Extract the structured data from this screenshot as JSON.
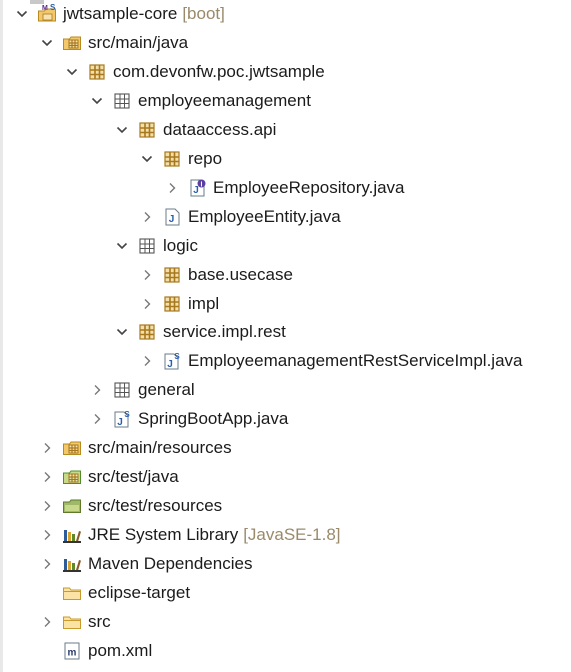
{
  "tree": [
    {
      "id": "jwtsample-core",
      "label": "jwtsample-core",
      "decoration": "[boot]",
      "icon": "project",
      "expanded": true,
      "depth": 0
    },
    {
      "id": "src-main-java",
      "label": "src/main/java",
      "icon": "source-folder",
      "expanded": true,
      "depth": 1
    },
    {
      "id": "pkg-root",
      "label": "com.devonfw.poc.jwtsample",
      "icon": "package",
      "expanded": true,
      "depth": 2
    },
    {
      "id": "pkg-employeemanagement",
      "label": "employeemanagement",
      "icon": "package-empty",
      "expanded": true,
      "depth": 3
    },
    {
      "id": "pkg-dataaccess-api",
      "label": "dataaccess.api",
      "icon": "package",
      "expanded": true,
      "depth": 4
    },
    {
      "id": "pkg-repo",
      "label": "repo",
      "icon": "package",
      "expanded": true,
      "depth": 5
    },
    {
      "id": "file-employeerepository",
      "label": "EmployeeRepository.java",
      "icon": "java-interface",
      "expanded": false,
      "depth": 6
    },
    {
      "id": "file-employeeentity",
      "label": "EmployeeEntity.java",
      "icon": "java-file",
      "expanded": false,
      "depth": 5
    },
    {
      "id": "pkg-logic",
      "label": "logic",
      "icon": "package-empty",
      "expanded": true,
      "depth": 4
    },
    {
      "id": "pkg-base-usecase",
      "label": "base.usecase",
      "icon": "package",
      "expanded": false,
      "depth": 5
    },
    {
      "id": "pkg-impl",
      "label": "impl",
      "icon": "package",
      "expanded": false,
      "depth": 5
    },
    {
      "id": "pkg-service-impl-rest",
      "label": "service.impl.rest",
      "icon": "package",
      "expanded": true,
      "depth": 4
    },
    {
      "id": "file-restserviceimpl",
      "label": "EmployeemanagementRestServiceImpl.java",
      "icon": "java-spring",
      "expanded": false,
      "depth": 5
    },
    {
      "id": "pkg-general",
      "label": "general",
      "icon": "package-empty",
      "expanded": false,
      "depth": 3
    },
    {
      "id": "file-springbootapp",
      "label": "SpringBootApp.java",
      "icon": "java-spring",
      "expanded": false,
      "depth": 3
    },
    {
      "id": "src-main-resources",
      "label": "src/main/resources",
      "icon": "source-folder",
      "expanded": false,
      "depth": 1
    },
    {
      "id": "src-test-java",
      "label": "src/test/java",
      "icon": "source-folder-test",
      "expanded": false,
      "depth": 1
    },
    {
      "id": "src-test-resources",
      "label": "src/test/resources",
      "icon": "source-folder-test-res",
      "expanded": false,
      "depth": 1
    },
    {
      "id": "jre-library",
      "label": "JRE System Library",
      "decoration": "[JavaSE-1.8]",
      "icon": "library",
      "expanded": false,
      "depth": 1
    },
    {
      "id": "maven-deps",
      "label": "Maven Dependencies",
      "icon": "library",
      "expanded": false,
      "depth": 1
    },
    {
      "id": "eclipse-target",
      "label": "eclipse-target",
      "icon": "folder",
      "leaf": true,
      "depth": 1
    },
    {
      "id": "src-folder",
      "label": "src",
      "icon": "folder",
      "expanded": false,
      "depth": 1
    },
    {
      "id": "pom-xml",
      "label": "pom.xml",
      "icon": "maven-file",
      "leaf": true,
      "depth": 1
    }
  ],
  "icon_symbols": {
    "project-badge": "M",
    "spring-badge": "S",
    "java-letter": "J",
    "interface-letter": "I"
  },
  "colors": {
    "package": "#a8781e",
    "source-folder": "#d9a530",
    "java": "#2a5ea8",
    "test-green": "#4f8f2a",
    "library": "#2e5e9a",
    "decoration": "#9a8a6a"
  }
}
